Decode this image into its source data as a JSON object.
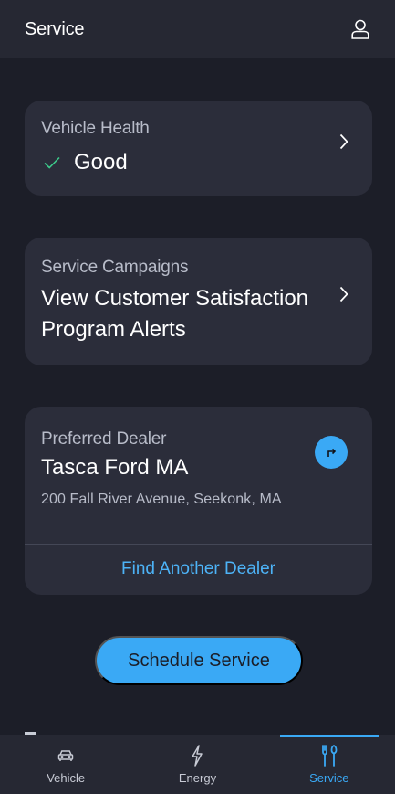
{
  "header": {
    "title": "Service",
    "profile_icon": "person-icon"
  },
  "vehicle_health": {
    "label": "Vehicle Health",
    "status": "Good",
    "status_color": "#3cc98a"
  },
  "service_campaigns": {
    "label": "Service Campaigns",
    "title": "View Customer Satisfaction Program Alerts"
  },
  "preferred_dealer": {
    "label": "Preferred Dealer",
    "name": "Tasca Ford MA",
    "address": "200 Fall River Avenue, Seekonk, MA",
    "find_another": "Find Another Dealer"
  },
  "schedule_button": "Schedule Service",
  "bottom_nav": {
    "items": [
      {
        "label": "Vehicle",
        "icon": "car-icon",
        "active": false
      },
      {
        "label": "Energy",
        "icon": "lightning-icon",
        "active": false
      },
      {
        "label": "Service",
        "icon": "tools-icon",
        "active": true
      }
    ]
  },
  "colors": {
    "accent": "#3aa9f5",
    "background": "#1c1e28",
    "card": "#2b2d3a",
    "header": "#262833"
  }
}
